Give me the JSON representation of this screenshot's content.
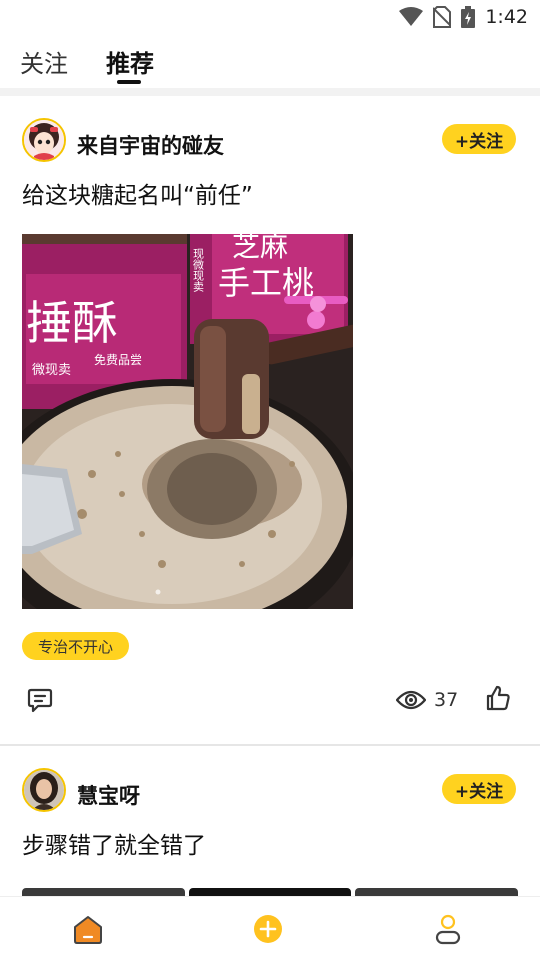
{
  "status_bar": {
    "time": "1:42"
  },
  "tabs": [
    {
      "label": "关注"
    },
    {
      "label": "推荐"
    }
  ],
  "posts": [
    {
      "username": "来自宇宙的碰友",
      "follow_label": "+关注",
      "text": "给这块糖起名叫“前任”",
      "tag": "专治不开心",
      "view_count": "37",
      "image_signs": {
        "left_big": "捶酥",
        "left_small_1": "微现卖",
        "left_small_2": "免费品尝",
        "right_top": "芝麻",
        "right_big": "手工桃",
        "right_side": "现微现卖"
      }
    },
    {
      "username": "慧宝呀",
      "follow_label": "+关注",
      "text": "步骤错了就全错了"
    }
  ],
  "colors": {
    "accent": "#ffd21f",
    "nav_active": "#f08a24"
  },
  "icons": {
    "comment": "comment-icon",
    "view": "eye-icon",
    "like": "thumbs-up-icon",
    "home": "home-icon",
    "add": "plus-circle-icon",
    "profile": "person-icon"
  }
}
